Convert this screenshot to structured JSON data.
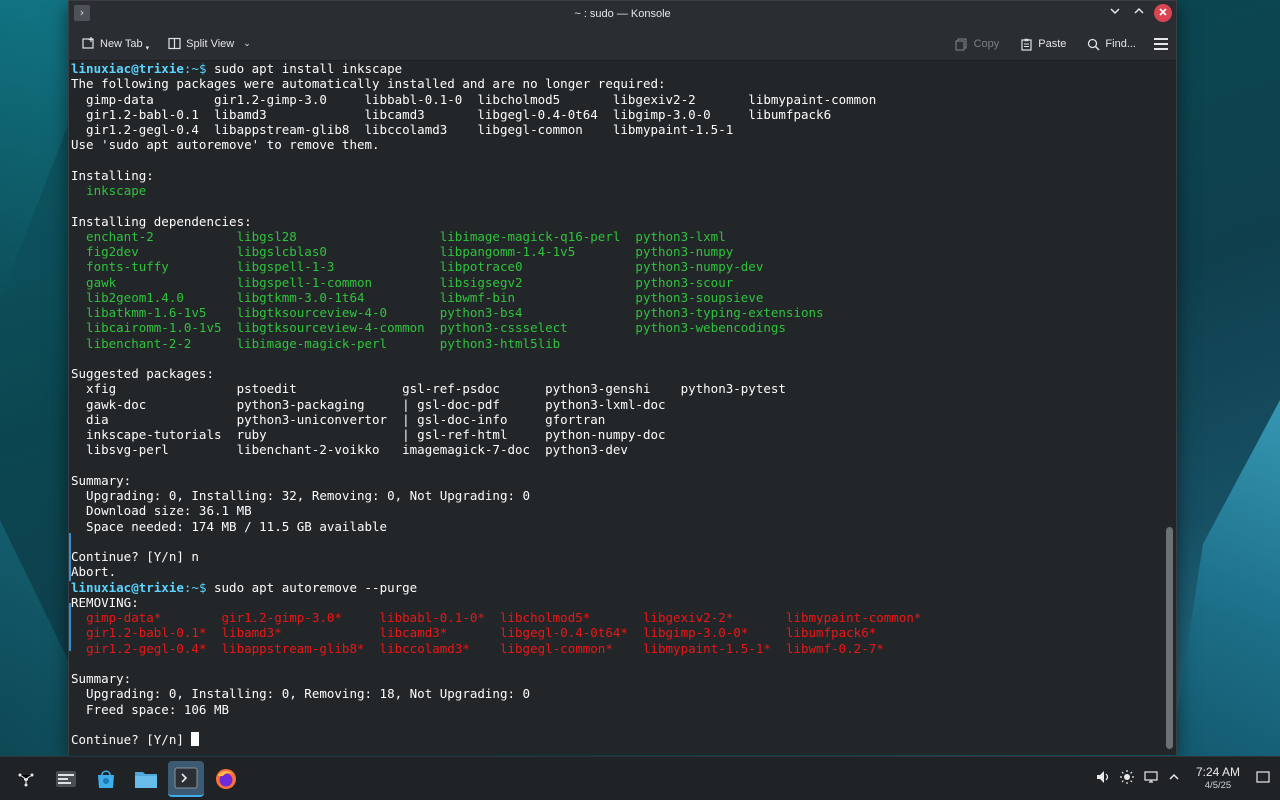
{
  "window": {
    "title": "~ : sudo — Konsole",
    "controls": [
      "minimize",
      "maximize",
      "close"
    ]
  },
  "toolbar": {
    "new_tab": "New Tab",
    "split_view": "Split View",
    "copy": "Copy",
    "paste": "Paste",
    "find": "Find..."
  },
  "terminal": {
    "lines": [
      {
        "segs": [
          {
            "t": "linuxiac@trixie",
            "c": "prompt-user"
          },
          {
            "t": ":~$ ",
            "c": "prompt-path"
          },
          {
            "t": "sudo apt install inkscape"
          }
        ]
      },
      {
        "segs": [
          {
            "t": "The following packages were automatically installed and are no longer required:"
          }
        ]
      },
      {
        "segs": [
          {
            "t": "  gimp-data        gir1.2-gimp-3.0     libbabl-0.1-0  libcholmod5       libgexiv2-2       libmypaint-common"
          }
        ]
      },
      {
        "segs": [
          {
            "t": "  gir1.2-babl-0.1  libamd3             libcamd3       libgegl-0.4-0t64  libgimp-3.0-0     libumfpack6"
          }
        ]
      },
      {
        "segs": [
          {
            "t": "  gir1.2-gegl-0.4  libappstream-glib8  libccolamd3    libgegl-common    libmypaint-1.5-1"
          }
        ]
      },
      {
        "segs": [
          {
            "t": "Use 'sudo apt autoremove' to remove them."
          }
        ]
      },
      {
        "segs": [
          {
            "t": ""
          }
        ]
      },
      {
        "segs": [
          {
            "t": "Installing:"
          }
        ]
      },
      {
        "segs": [
          {
            "t": "  "
          },
          {
            "t": "inkscape",
            "c": "g2"
          }
        ]
      },
      {
        "segs": [
          {
            "t": ""
          }
        ]
      },
      {
        "segs": [
          {
            "t": "Installing dependencies:"
          }
        ]
      },
      {
        "segs": [
          {
            "t": "  enchant-2           libgsl28                   libimage-magick-q16-perl  python3-lxml",
            "c": "g2"
          }
        ]
      },
      {
        "segs": [
          {
            "t": "  fig2dev             libgslcblas0               libpangomm-1.4-1v5        python3-numpy",
            "c": "g2"
          }
        ]
      },
      {
        "segs": [
          {
            "t": "  fonts-tuffy         libgspell-1-3              libpotrace0               python3-numpy-dev",
            "c": "g2"
          }
        ]
      },
      {
        "segs": [
          {
            "t": "  gawk                libgspell-1-common         libsigsegv2               python3-scour",
            "c": "g2"
          }
        ]
      },
      {
        "segs": [
          {
            "t": "  lib2geom1.4.0       libgtkmm-3.0-1t64          libwmf-bin                python3-soupsieve",
            "c": "g2"
          }
        ]
      },
      {
        "segs": [
          {
            "t": "  libatkmm-1.6-1v5    libgtksourceview-4-0       python3-bs4               python3-typing-extensions",
            "c": "g2"
          }
        ]
      },
      {
        "segs": [
          {
            "t": "  libcairomm-1.0-1v5  libgtksourceview-4-common  python3-cssselect         python3-webencodings",
            "c": "g2"
          }
        ]
      },
      {
        "segs": [
          {
            "t": "  libenchant-2-2      libimage-magick-perl       python3-html5lib",
            "c": "g2"
          }
        ]
      },
      {
        "segs": [
          {
            "t": ""
          }
        ]
      },
      {
        "segs": [
          {
            "t": "Suggested packages:"
          }
        ]
      },
      {
        "segs": [
          {
            "t": "  xfig                pstoedit              gsl-ref-psdoc      python3-genshi    python3-pytest"
          }
        ]
      },
      {
        "segs": [
          {
            "t": "  gawk-doc            python3-packaging     | gsl-doc-pdf      python3-lxml-doc"
          }
        ]
      },
      {
        "segs": [
          {
            "t": "  dia                 python3-uniconvertor  | gsl-doc-info     gfortran"
          }
        ]
      },
      {
        "segs": [
          {
            "t": "  inkscape-tutorials  ruby                  | gsl-ref-html     python-numpy-doc"
          }
        ]
      },
      {
        "segs": [
          {
            "t": "  libsvg-perl         libenchant-2-voikko   imagemagick-7-doc  python3-dev"
          }
        ]
      },
      {
        "segs": [
          {
            "t": ""
          }
        ]
      },
      {
        "segs": [
          {
            "t": "Summary:"
          }
        ]
      },
      {
        "segs": [
          {
            "t": "  Upgrading: 0, Installing: 32, Removing: 0, Not Upgrading: 0"
          }
        ]
      },
      {
        "segs": [
          {
            "t": "  Download size: 36.1 MB"
          }
        ]
      },
      {
        "segs": [
          {
            "t": "  Space needed: 174 MB / 11.5 GB available"
          }
        ]
      },
      {
        "segs": [
          {
            "t": ""
          }
        ]
      },
      {
        "segs": [
          {
            "t": "Continue? [Y/n] n"
          }
        ]
      },
      {
        "segs": [
          {
            "t": "Abort."
          }
        ]
      },
      {
        "segs": [
          {
            "t": "linuxiac@trixie",
            "c": "prompt-user"
          },
          {
            "t": ":~$ ",
            "c": "prompt-path"
          },
          {
            "t": "sudo apt autoremove --purge"
          }
        ]
      },
      {
        "segs": [
          {
            "t": "REMOVING:"
          }
        ]
      },
      {
        "segs": [
          {
            "t": "  "
          },
          {
            "t": "gimp-data*        gir1.2-gimp-3.0*     libbabl-0.1-0*  libcholmod5*       libgexiv2-2*       libmypaint-common*",
            "c": "r"
          }
        ]
      },
      {
        "segs": [
          {
            "t": "  "
          },
          {
            "t": "gir1.2-babl-0.1*  libamd3*             libcamd3*       libgegl-0.4-0t64*  libgimp-3.0-0*     libumfpack6*",
            "c": "r"
          }
        ]
      },
      {
        "segs": [
          {
            "t": "  "
          },
          {
            "t": "gir1.2-gegl-0.4*  libappstream-glib8*  libccolamd3*    libgegl-common*    libmypaint-1.5-1*  libwmf-0.2-7*",
            "c": "r"
          }
        ]
      },
      {
        "segs": [
          {
            "t": ""
          }
        ]
      },
      {
        "segs": [
          {
            "t": "Summary:"
          }
        ]
      },
      {
        "segs": [
          {
            "t": "  Upgrading: 0, Installing: 0, Removing: 18, Not Upgrading: 0"
          }
        ]
      },
      {
        "segs": [
          {
            "t": "  Freed space: 106 MB"
          }
        ]
      },
      {
        "segs": [
          {
            "t": ""
          }
        ]
      },
      {
        "segs": [
          {
            "t": "Continue? [Y/n] "
          }
        ],
        "cursor": true
      }
    ]
  },
  "taskbar": {
    "apps": [
      "application-launcher-icon",
      "pager-icon",
      "discover-store-icon",
      "file-manager-icon",
      "konsole-icon",
      "firefox-icon"
    ],
    "tray": {
      "time": "7:24 AM",
      "date": "4/5/25"
    }
  }
}
